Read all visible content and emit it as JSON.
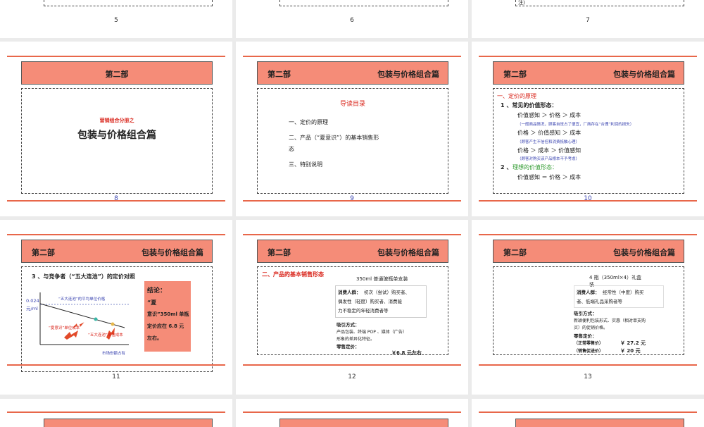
{
  "top_row": {
    "numbers": [
      "5",
      "6",
      "7"
    ],
    "fragment_7": "注)"
  },
  "slide8": {
    "number": "8",
    "header": "第二部",
    "subtitle": "营销组合分册之",
    "title": "包装与价格组合篇"
  },
  "slide9": {
    "number": "9",
    "header_left": "第二部",
    "header_right": "包装与价格组合篇",
    "guide_title": "导读目录",
    "items": [
      "一、定价的原理",
      "二、产品（“夏意识”）的基本销售形",
      "态",
      "三、特别说明"
    ]
  },
  "slide10": {
    "number": "10",
    "header_left": "第二部",
    "header_right": "包装与价格组合篇",
    "section": "一、定价的原理",
    "sub1": "1 、常见的价值形态：",
    "f1": "价值感知  ＞  价格  ＞  成本",
    "n1": "（一般商品情况，顾客自觉占了便宜，厂商存在“合理”利润的损失）",
    "f2": "价格  ＞  价值感知  ＞  成本",
    "n2": "（顾客产生不信任和消费抵触心理）",
    "f3": "价格  ＞  成本  ＞  价值感知",
    "n3": "（顾客对购买该产品根本不予考虑）",
    "sub2_num": "2 、",
    "sub2": "理想的价值形态：",
    "f4": "价值感知  ＝  价格  ＞  成本"
  },
  "slide11": {
    "number": "11",
    "header_left": "第二部",
    "header_right": "包装与价格组合篇",
    "heading": "3 、与竞争者（“五大连池”）的定价对照",
    "y_value": "0.024",
    "y_unit": "元/ml",
    "line_label": "“五大连池”的平均单位价格",
    "arrow1_label": "“夏意识”单位成本",
    "arrow2_label": "“五大连池”单位成本",
    "x_label": "市场份额占有",
    "conclusion_title": "结论：",
    "conclusion_body": [
      "“夏",
      "意识”350ml 单瓶",
      "定价应在 6.8 元",
      "左右。"
    ]
  },
  "slide12": {
    "number": "12",
    "header_left": "第二部",
    "header_right": "包装与价格组合篇",
    "section": "二、产品的基本销售形态",
    "product": "350ml 普通玻瓶单支装",
    "consumer_label": "消费人群：",
    "consumer_lines": [
      "初次（尝试）购买者、",
      "偶发性（轻度）购买者、消费能",
      "力不稳定的年轻消费者等"
    ],
    "attract_label": "吸引方式：",
    "attract_lines": [
      "产品包装、终端 POP 、媒体（广告）",
      "形象的差异化特征。"
    ],
    "retail_label": "零售定价：",
    "price": "￥6.8 元左右"
  },
  "slide13": {
    "number": "13",
    "header_left": "第二部",
    "header_right": "包装与价格组合篇",
    "product": [
      "4 瓶（350ml×4）礼盒",
      "装"
    ],
    "consumer_label": "消费人群：",
    "consumer_lines": [
      "经常性（中度）购买",
      "者、低端礼品采购者等"
    ],
    "attract_label": "吸引方式：",
    "attract_lines": [
      "新颖便利包装形式、实惠（相对单支购",
      "买）的促销价格。"
    ],
    "retail_label": "零售定价：",
    "price_rows": [
      {
        "label": "（正常零售价）",
        "value": "￥ 27.2 元"
      },
      {
        "label": "（销售促进价）",
        "value": "￥ 20 元"
      }
    ]
  },
  "colors": {
    "header_fill": "#f58c78",
    "accent_line": "#e8674a",
    "red_text": "#d9241a",
    "blue_text": "#3a44b0"
  }
}
